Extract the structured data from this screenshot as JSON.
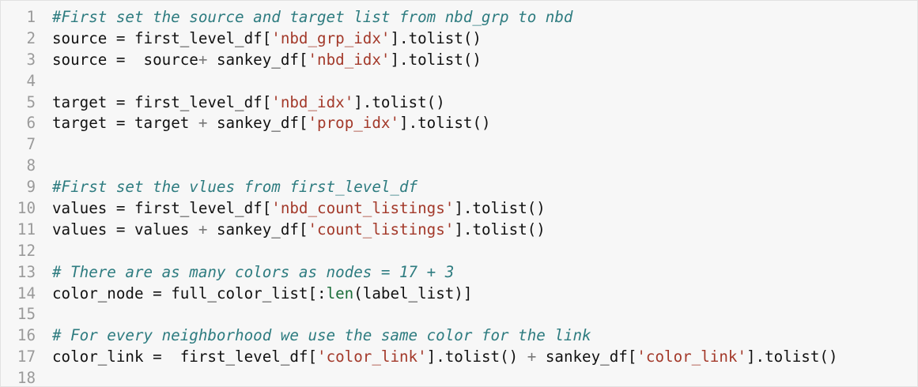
{
  "lines": [
    {
      "n": "1",
      "tokens": [
        {
          "t": "#First set the source and target list from nbd_grp to nbd",
          "c": "cm"
        }
      ]
    },
    {
      "n": "2",
      "tokens": [
        {
          "t": "source ",
          "c": ""
        },
        {
          "t": "=",
          "c": ""
        },
        {
          "t": " first_level_df[",
          "c": ""
        },
        {
          "t": "'nbd_grp_idx'",
          "c": "st"
        },
        {
          "t": "].tolist()",
          "c": ""
        }
      ]
    },
    {
      "n": "3",
      "tokens": [
        {
          "t": "source ",
          "c": ""
        },
        {
          "t": "=",
          "c": ""
        },
        {
          "t": "  source",
          "c": ""
        },
        {
          "t": "+",
          "c": "op"
        },
        {
          "t": " sankey_df[",
          "c": ""
        },
        {
          "t": "'nbd_idx'",
          "c": "st"
        },
        {
          "t": "].tolist()",
          "c": ""
        }
      ]
    },
    {
      "n": "4",
      "tokens": []
    },
    {
      "n": "5",
      "tokens": [
        {
          "t": "target ",
          "c": ""
        },
        {
          "t": "=",
          "c": ""
        },
        {
          "t": " first_level_df[",
          "c": ""
        },
        {
          "t": "'nbd_idx'",
          "c": "st"
        },
        {
          "t": "].tolist()",
          "c": ""
        }
      ]
    },
    {
      "n": "6",
      "tokens": [
        {
          "t": "target ",
          "c": ""
        },
        {
          "t": "=",
          "c": ""
        },
        {
          "t": " target ",
          "c": ""
        },
        {
          "t": "+",
          "c": "op"
        },
        {
          "t": " sankey_df[",
          "c": ""
        },
        {
          "t": "'prop_idx'",
          "c": "st"
        },
        {
          "t": "].tolist()",
          "c": ""
        }
      ]
    },
    {
      "n": "7",
      "tokens": []
    },
    {
      "n": "8",
      "tokens": []
    },
    {
      "n": "9",
      "tokens": [
        {
          "t": "#First set the vlues from first_level_df",
          "c": "cm"
        }
      ]
    },
    {
      "n": "10",
      "tokens": [
        {
          "t": "values ",
          "c": ""
        },
        {
          "t": "=",
          "c": ""
        },
        {
          "t": " first_level_df[",
          "c": ""
        },
        {
          "t": "'nbd_count_listings'",
          "c": "st"
        },
        {
          "t": "].tolist()",
          "c": ""
        }
      ]
    },
    {
      "n": "11",
      "tokens": [
        {
          "t": "values ",
          "c": ""
        },
        {
          "t": "=",
          "c": ""
        },
        {
          "t": " values ",
          "c": ""
        },
        {
          "t": "+",
          "c": "op"
        },
        {
          "t": " sankey_df[",
          "c": ""
        },
        {
          "t": "'count_listings'",
          "c": "st"
        },
        {
          "t": "].tolist()",
          "c": ""
        }
      ]
    },
    {
      "n": "12",
      "tokens": []
    },
    {
      "n": "13",
      "tokens": [
        {
          "t": "# There are as many colors as nodes = 17 + 3",
          "c": "cm"
        }
      ]
    },
    {
      "n": "14",
      "tokens": [
        {
          "t": "color_node ",
          "c": ""
        },
        {
          "t": "=",
          "c": ""
        },
        {
          "t": " full_color_list[:",
          "c": ""
        },
        {
          "t": "len",
          "c": "bi"
        },
        {
          "t": "(label_list)]",
          "c": ""
        }
      ]
    },
    {
      "n": "15",
      "tokens": []
    },
    {
      "n": "16",
      "tokens": [
        {
          "t": "# For every neighborhood we use the same color for the link",
          "c": "cm"
        }
      ]
    },
    {
      "n": "17",
      "tokens": [
        {
          "t": "color_link ",
          "c": ""
        },
        {
          "t": "=",
          "c": ""
        },
        {
          "t": "  first_level_df[",
          "c": ""
        },
        {
          "t": "'color_link'",
          "c": "st"
        },
        {
          "t": "].tolist() ",
          "c": ""
        },
        {
          "t": "+",
          "c": "op"
        },
        {
          "t": " sankey_df[",
          "c": ""
        },
        {
          "t": "'color_link'",
          "c": "st"
        },
        {
          "t": "].tolist()",
          "c": ""
        }
      ]
    },
    {
      "n": "18",
      "tokens": []
    }
  ],
  "colors": {
    "background": "#f7f7f7",
    "line_number": "#9a9a9a",
    "comment": "#2e7c80",
    "string": "#a3392a",
    "operator": "#777777",
    "builtin": "#1c6e3a"
  }
}
